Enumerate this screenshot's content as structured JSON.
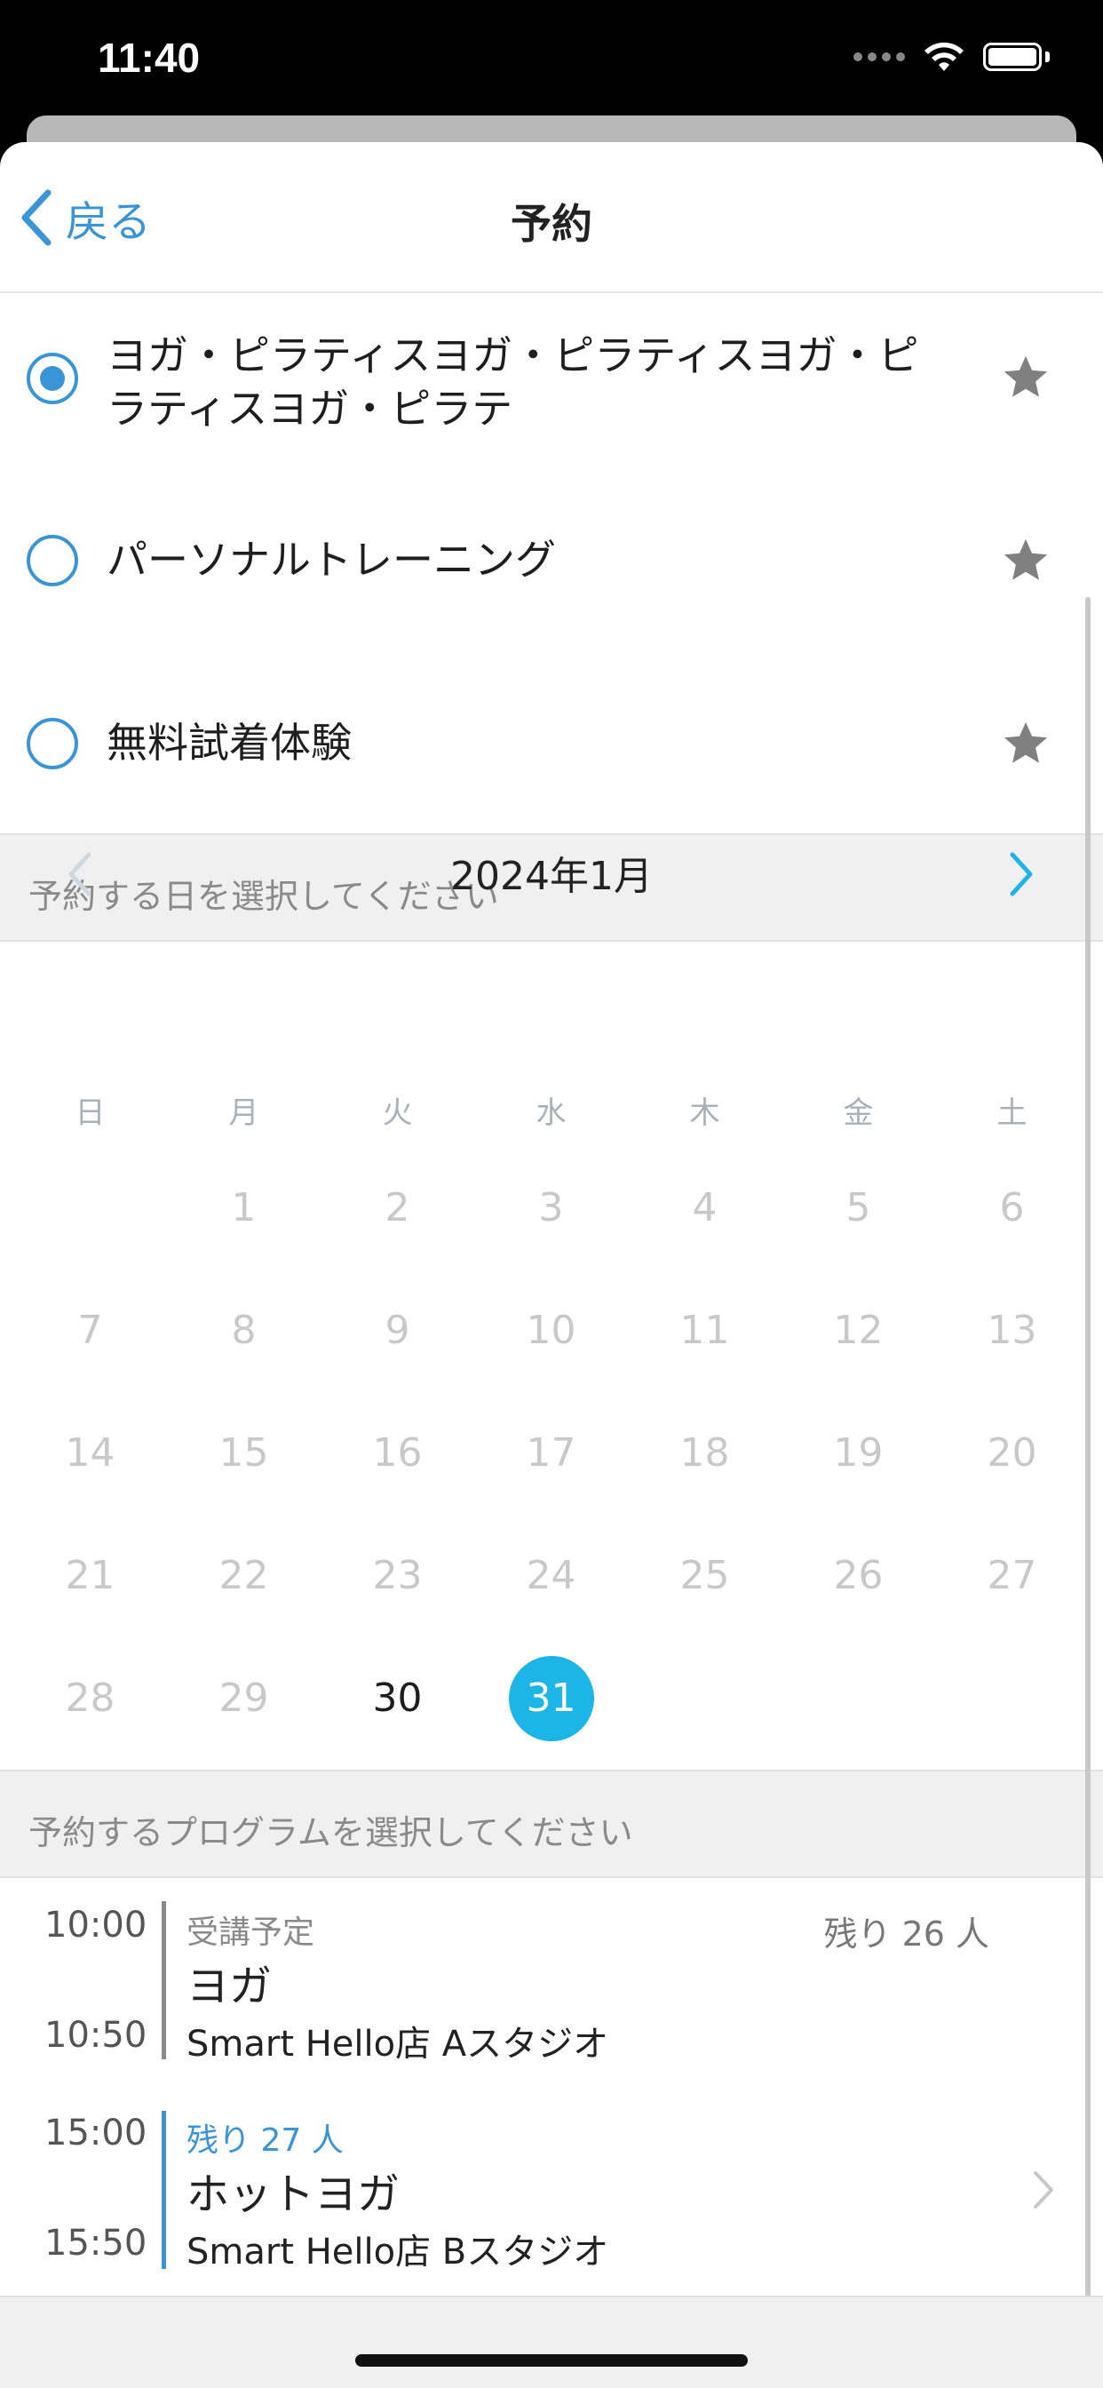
{
  "status_bar": {
    "time": "11:40"
  },
  "nav": {
    "back_label": "戻る",
    "title": "予約"
  },
  "options": [
    {
      "label": "ヨガ・ピラティスヨガ・ピラティスヨガ・ピラティスヨガ・ピラテ",
      "selected": true
    },
    {
      "label": "パーソナルトレーニング",
      "selected": false
    },
    {
      "label": "無料試着体験",
      "selected": false
    }
  ],
  "date_section": {
    "header": "予約する日を選択してください"
  },
  "calendar": {
    "title": "2024年1月",
    "weekdays": [
      "日",
      "月",
      "火",
      "水",
      "木",
      "金",
      "土"
    ],
    "days": [
      "1",
      "2",
      "3",
      "4",
      "5",
      "6",
      "7",
      "8",
      "9",
      "10",
      "11",
      "12",
      "13",
      "14",
      "15",
      "16",
      "17",
      "18",
      "19",
      "20",
      "21",
      "22",
      "23",
      "24",
      "25",
      "26",
      "27",
      "28",
      "29",
      "30",
      "31"
    ],
    "selected_day": "31",
    "available_days": [
      "30",
      "31"
    ]
  },
  "program_section": {
    "header": "予約するプログラムを選択してください"
  },
  "programs": [
    {
      "start": "10:00",
      "end": "10:50",
      "status": "受講予定",
      "name": "ヨガ",
      "place": "Smart Hello店 Aスタジオ",
      "remaining": "残り 26 人"
    },
    {
      "start": "15:00",
      "end": "15:50",
      "status": "残り 27 人",
      "name": "ホットヨガ",
      "place": "Smart Hello店 Bスタジオ"
    }
  ],
  "colors": {
    "accent": "#3a95d6",
    "selected_day": "#1cb5e8",
    "star": "#808080"
  }
}
